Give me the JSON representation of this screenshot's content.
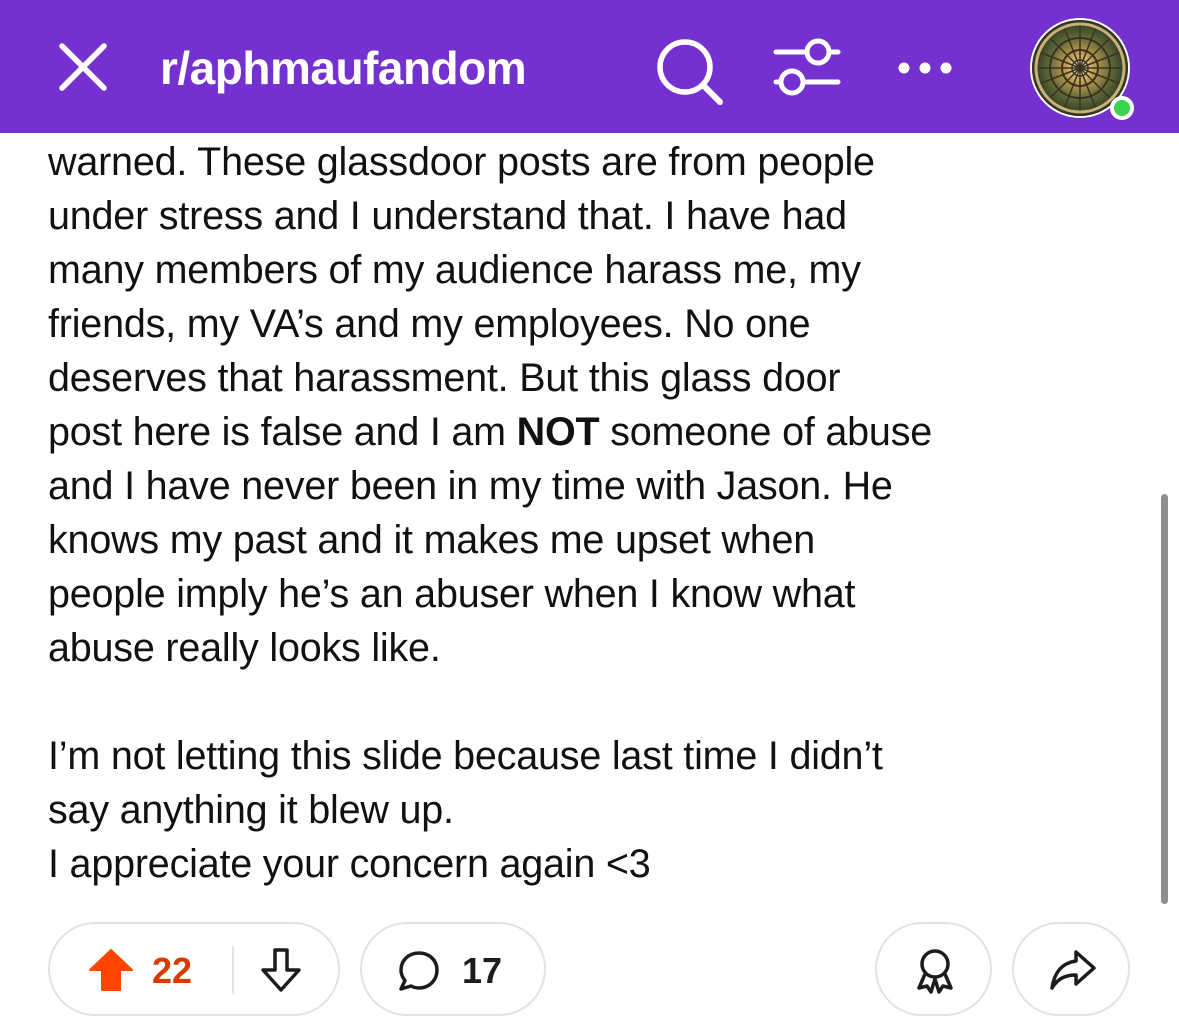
{
  "header": {
    "subreddit": "r/aphmaufandom",
    "icons": {
      "close": "close-icon",
      "search": "search-icon",
      "filter": "filter-icon",
      "more": "more-icon",
      "avatar": "avatar",
      "status": "online-status-icon"
    },
    "background_color": "#7431cf"
  },
  "post": {
    "lines": [
      "warned. These glassdoor posts are from people",
      "under stress and I understand that. I have had",
      "many members of my audience harass me, my",
      "friends, my VA’s and my employees. No one",
      "deserves that harassment. But this glass door",
      "post here is false and I am ",
      "NOT",
      " someone of abuse",
      "and I have never been in my time with Jason. He",
      "knows my past and it makes me upset when",
      "people imply he’s an abuser when I know what",
      "abuse really looks like.",
      "I’m not letting this slide because last time I didn’t",
      "say anything it blew up.",
      "I appreciate your concern again <3"
    ]
  },
  "actions": {
    "upvotes": "22",
    "comments": "17",
    "upvote_color": "#ff4500",
    "icons": {
      "upvote": "upvote-arrow-icon",
      "downvote": "downvote-arrow-icon",
      "comment": "comment-bubble-icon",
      "award": "award-icon",
      "share": "share-icon"
    }
  }
}
